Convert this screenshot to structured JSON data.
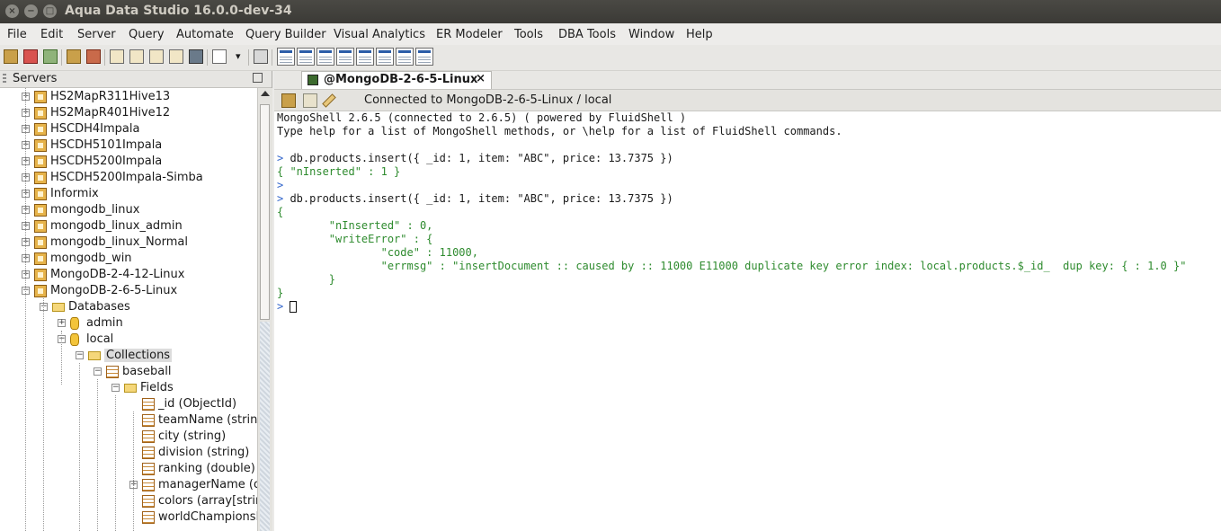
{
  "window": {
    "title": "Aqua Data Studio 16.0.0-dev-34",
    "controls": {
      "close": "×",
      "minimize": "−",
      "maximize": "□"
    }
  },
  "menu": [
    "File",
    "Edit",
    "Server",
    "Query",
    "Automate",
    "Query Builder",
    "Visual Analytics",
    "ER Modeler",
    "Tools",
    "DBA Tools",
    "Window",
    "Help"
  ],
  "toolbar": {
    "dropdown_arrow": "▾"
  },
  "servers_panel": {
    "title": "Servers",
    "tree": [
      {
        "label": "HS2MapR311Hive13",
        "type": "server",
        "expander": "+"
      },
      {
        "label": "HS2MapR401Hive12",
        "type": "server",
        "expander": "+"
      },
      {
        "label": "HSCDH4Impala",
        "type": "server",
        "expander": "+"
      },
      {
        "label": "HSCDH5101Impala",
        "type": "server",
        "expander": "+"
      },
      {
        "label": "HSCDH5200Impala",
        "type": "server",
        "expander": "+"
      },
      {
        "label": "HSCDH5200Impala-Simba",
        "type": "server",
        "expander": "+"
      },
      {
        "label": "Informix",
        "type": "server",
        "expander": "+"
      },
      {
        "label": "mongodb_linux",
        "type": "server",
        "expander": "+"
      },
      {
        "label": "mongodb_linux_admin",
        "type": "server",
        "expander": "+"
      },
      {
        "label": "mongodb_linux_Normal",
        "type": "server",
        "expander": "+"
      },
      {
        "label": "mongodb_win",
        "type": "server",
        "expander": "+"
      },
      {
        "label": "MongoDB-2-4-12-Linux",
        "type": "server",
        "expander": "+"
      },
      {
        "label": "MongoDB-2-6-5-Linux",
        "type": "server",
        "expander": "−"
      },
      {
        "label": "Databases",
        "type": "folder",
        "expander": "−"
      },
      {
        "label": "admin",
        "type": "db",
        "expander": "+"
      },
      {
        "label": "local",
        "type": "db",
        "expander": "−"
      },
      {
        "label": "Collections",
        "type": "folder",
        "expander": "−"
      },
      {
        "label": "baseball",
        "type": "table",
        "expander": "−"
      },
      {
        "label": "Fields",
        "type": "folder",
        "expander": "−"
      },
      {
        "label": "_id (ObjectId)",
        "type": "field",
        "expander": ""
      },
      {
        "label": "teamName (string)",
        "type": "field",
        "expander": ""
      },
      {
        "label": "city (string)",
        "type": "field",
        "expander": ""
      },
      {
        "label": "division (string)",
        "type": "field",
        "expander": ""
      },
      {
        "label": "ranking (double)",
        "type": "field",
        "expander": ""
      },
      {
        "label": "managerName (object)",
        "type": "field",
        "expander": "+"
      },
      {
        "label": "colors (array[string])",
        "type": "field",
        "expander": ""
      },
      {
        "label": "worldChampionships",
        "type": "field",
        "expander": ""
      }
    ]
  },
  "editor": {
    "tab_label": "@MongoDB-2-6-5-Linux",
    "tab_close": "×",
    "connection_status": "Connected to MongoDB-2-6-5-Linux / local",
    "console_lines": [
      {
        "text": "MongoShell 2.6.5 (connected to 2.6.5) ( powered by FluidShell )",
        "style": "dark"
      },
      {
        "text": "Type help for a list of MongoShell methods, or \\help for a list of FluidShell commands.",
        "style": "dark"
      },
      {
        "text": "",
        "style": "dark"
      },
      {
        "text": "> db.products.insert({ _id: 1, item: \"ABC\", price: 13.7375 })",
        "style": "prompt"
      },
      {
        "text": "{ \"nInserted\" : 1 }",
        "style": "green"
      },
      {
        "text": ">",
        "style": "blue"
      },
      {
        "text": "> db.products.insert({ _id: 1, item: \"ABC\", price: 13.7375 })",
        "style": "prompt"
      },
      {
        "text": "{",
        "style": "green"
      },
      {
        "text": "        \"nInserted\" : 0,",
        "style": "green"
      },
      {
        "text": "        \"writeError\" : {",
        "style": "green"
      },
      {
        "text": "                \"code\" : 11000,",
        "style": "green"
      },
      {
        "text": "                \"errmsg\" : \"insertDocument :: caused by :: 11000 E11000 duplicate key error index: local.products.$_id_  dup key: { : 1.0 }\"",
        "style": "green"
      },
      {
        "text": "        }",
        "style": "green"
      },
      {
        "text": "}",
        "style": "green"
      },
      {
        "text": ">",
        "style": "blue"
      }
    ]
  },
  "colors": {
    "console_text": "#1a1a1a",
    "console_result": "#2e8b2e",
    "prompt": "#3366cc"
  }
}
